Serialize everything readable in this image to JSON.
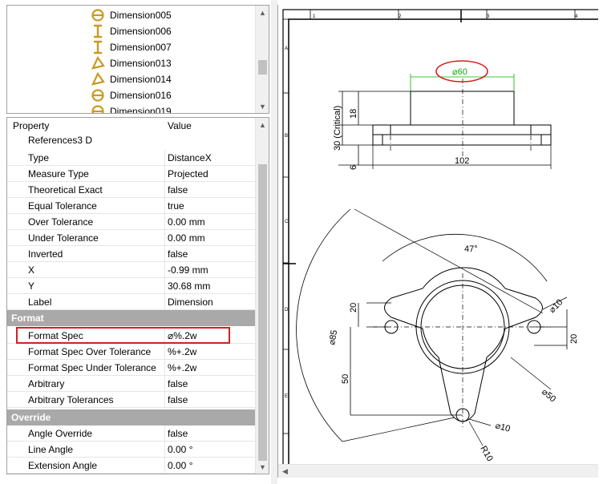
{
  "tree": {
    "items": [
      {
        "label": "Dimension005",
        "icon": "diameter-dimension-icon"
      },
      {
        "label": "Dimension006",
        "icon": "vertical-dimension-icon"
      },
      {
        "label": "Dimension007",
        "icon": "vertical-dimension-icon"
      },
      {
        "label": "Dimension013",
        "icon": "angle-dimension-icon"
      },
      {
        "label": "Dimension014",
        "icon": "angle-dimension-icon"
      },
      {
        "label": "Dimension016",
        "icon": "diameter-dimension-icon"
      },
      {
        "label": "Dimension019",
        "icon": "diameter-dimension-icon"
      }
    ]
  },
  "properties": {
    "header_property": "Property",
    "header_value": "Value",
    "truncated_row": "References3 D",
    "rows": [
      {
        "name": "Type",
        "value": "DistanceX"
      },
      {
        "name": "Measure Type",
        "value": "Projected"
      },
      {
        "name": "Theoretical Exact",
        "value": "false"
      },
      {
        "name": "Equal Tolerance",
        "value": "true"
      },
      {
        "name": "Over Tolerance",
        "value": "0.00 mm"
      },
      {
        "name": "Under Tolerance",
        "value": "0.00 mm"
      },
      {
        "name": "Inverted",
        "value": "false"
      },
      {
        "name": "X",
        "value": "-0.99 mm"
      },
      {
        "name": "Y",
        "value": "30.68 mm"
      },
      {
        "name": "Label",
        "value": "Dimension"
      }
    ],
    "format_section": "Format",
    "format_rows": [
      {
        "name": "Format Spec",
        "value": "⌀%.2w",
        "highlighted": true
      },
      {
        "name": "Format Spec Over Tolerance",
        "value": "%+.2w"
      },
      {
        "name": "Format Spec Under Tolerance",
        "value": "%+.2w"
      },
      {
        "name": "Arbitrary",
        "value": "false"
      },
      {
        "name": "Arbitrary Tolerances",
        "value": "false"
      }
    ],
    "override_section": "Override",
    "override_rows": [
      {
        "name": "Angle Override",
        "value": "false"
      },
      {
        "name": "Line Angle",
        "value": "0.00 °"
      },
      {
        "name": "Extension Angle",
        "value": "0.00 °"
      }
    ]
  },
  "drawing": {
    "border_numbers": [
      "1",
      "2",
      "3",
      "4"
    ],
    "border_letters": [
      "A",
      "B",
      "C",
      "D",
      "E"
    ],
    "dims": {
      "dia60": "⌀60",
      "critical": "30 (Critical)",
      "d18": "18",
      "d6": "6",
      "d102": "102",
      "angle47": "47°",
      "d20a": "20",
      "d20b": "20",
      "d50": "50",
      "d85": "⌀85",
      "dia10a": "⌀10",
      "dia50": "⌀50",
      "dia10b": "⌀10",
      "r10": "R10"
    },
    "colors": {
      "highlight": "#d32020",
      "dimension_green": "#00b000",
      "line": "#000000"
    }
  }
}
